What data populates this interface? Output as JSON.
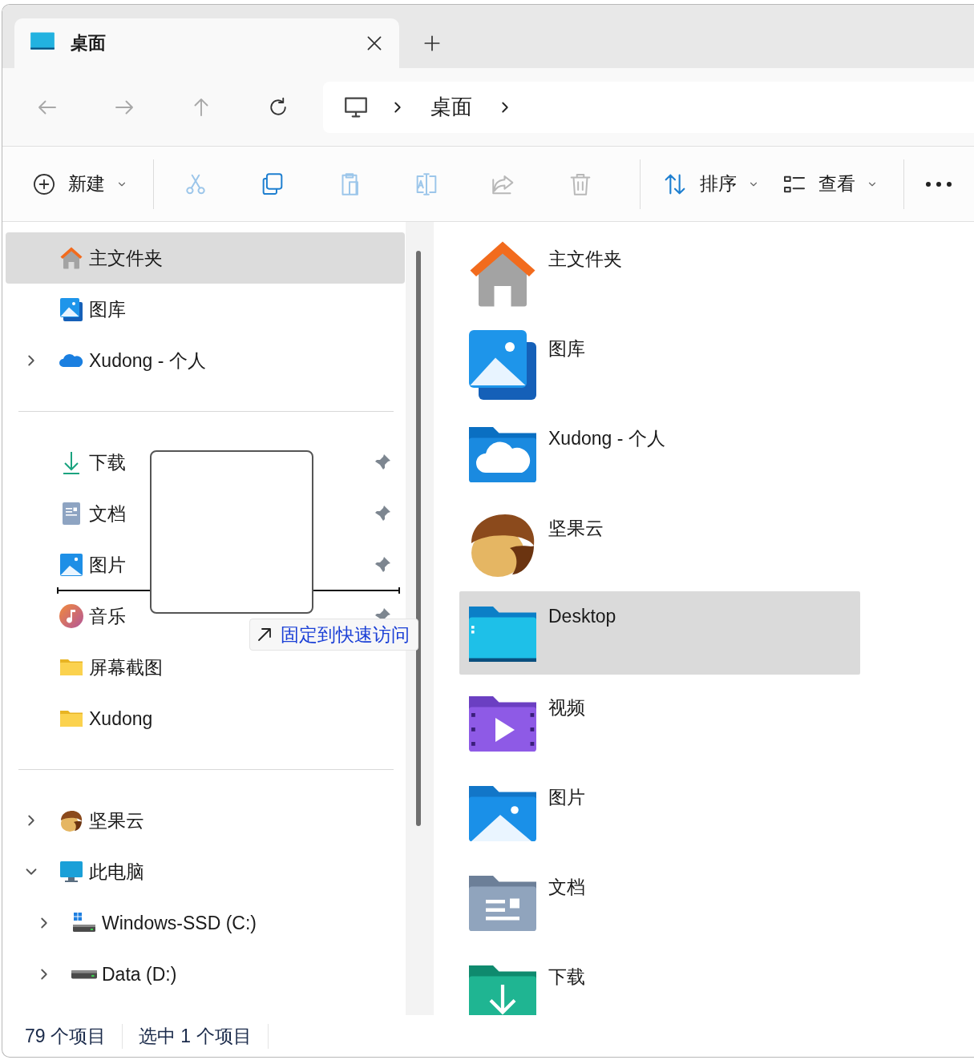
{
  "tabs": [
    {
      "title": "桌面",
      "kind": "desktop",
      "selected": true
    }
  ],
  "nav_buttons": [
    {
      "kind": "back",
      "disabled": true
    },
    {
      "kind": "forward",
      "disabled": true
    },
    {
      "kind": "up",
      "disabled": true
    },
    {
      "kind": "refresh",
      "disabled": false
    }
  ],
  "breadcrumb": {
    "items": [
      {
        "label": "桌面"
      }
    ]
  },
  "toolbar": [
    {
      "kind": "new",
      "label": "新建",
      "dropdown": true,
      "disabled": false
    },
    {
      "kind": "separator"
    },
    {
      "kind": "cut",
      "disabled": true
    },
    {
      "kind": "copy",
      "disabled": false
    },
    {
      "kind": "paste",
      "disabled": true
    },
    {
      "kind": "rename",
      "disabled": true
    },
    {
      "kind": "share",
      "disabled": true
    },
    {
      "kind": "delete",
      "disabled": true
    },
    {
      "kind": "separator"
    },
    {
      "kind": "sort",
      "label": "排序",
      "dropdown": true,
      "disabled": false
    },
    {
      "kind": "view",
      "label": "查看",
      "dropdown": true,
      "disabled": false
    },
    {
      "kind": "separator"
    },
    {
      "kind": "more",
      "disabled": false
    }
  ],
  "sidebar": {
    "sections": [
      {
        "items": [
          {
            "kind": "home",
            "label": "主文件夹",
            "selected": true
          },
          {
            "kind": "gallery",
            "label": "图库",
            "selected": false
          },
          {
            "kind": "onedrive",
            "label": "Xudong - 个人",
            "selected": false,
            "expanded": false
          }
        ]
      },
      {
        "items": [
          {
            "kind": "downloads",
            "label": "下载",
            "selected": false,
            "pinned": true
          },
          {
            "kind": "documents",
            "label": "文档",
            "selected": false,
            "pinned": true
          },
          {
            "kind": "pictures",
            "label": "图片",
            "selected": false,
            "pinned": true
          },
          {
            "kind": "drop_marker"
          },
          {
            "kind": "music",
            "label": "音乐",
            "selected": false,
            "pinned": true
          },
          {
            "kind": "folder",
            "label": "屏幕截图",
            "selected": false,
            "pinned": false
          },
          {
            "kind": "folder",
            "label": "Xudong",
            "selected": false,
            "pinned": false
          }
        ]
      },
      {
        "items": [
          {
            "kind": "nutstore",
            "label": "坚果云",
            "selected": false,
            "expanded": false
          },
          {
            "kind": "pc",
            "label": "此电脑",
            "selected": false,
            "expanded": true,
            "children": [
              {
                "kind": "windows_drive",
                "label": "Windows-SSD (C:)",
                "selected": false,
                "expanded": false
              },
              {
                "kind": "drive",
                "label": "Data (D:)",
                "selected": false,
                "expanded": false
              }
            ]
          }
        ]
      }
    ]
  },
  "drag": {
    "tooltip": "固定到快速访问"
  },
  "files": [
    {
      "label": "主文件夹",
      "kind": "home",
      "selected": false
    },
    {
      "label": "图库",
      "kind": "gallery",
      "selected": false
    },
    {
      "label": "Xudong - 个人",
      "kind": "onedrive",
      "selected": false
    },
    {
      "label": "坚果云",
      "kind": "nutstore",
      "selected": false
    },
    {
      "label": "Desktop",
      "kind": "desktop",
      "selected": true
    },
    {
      "label": "视频",
      "kind": "videos",
      "selected": false
    },
    {
      "label": "图片",
      "kind": "pictures",
      "selected": false
    },
    {
      "label": "文档",
      "kind": "documents",
      "selected": false
    },
    {
      "label": "下载",
      "kind": "downloads",
      "selected": false
    }
  ],
  "status_bar": {
    "item_count": "79 个项目",
    "selection": "选中 1 个项目"
  }
}
